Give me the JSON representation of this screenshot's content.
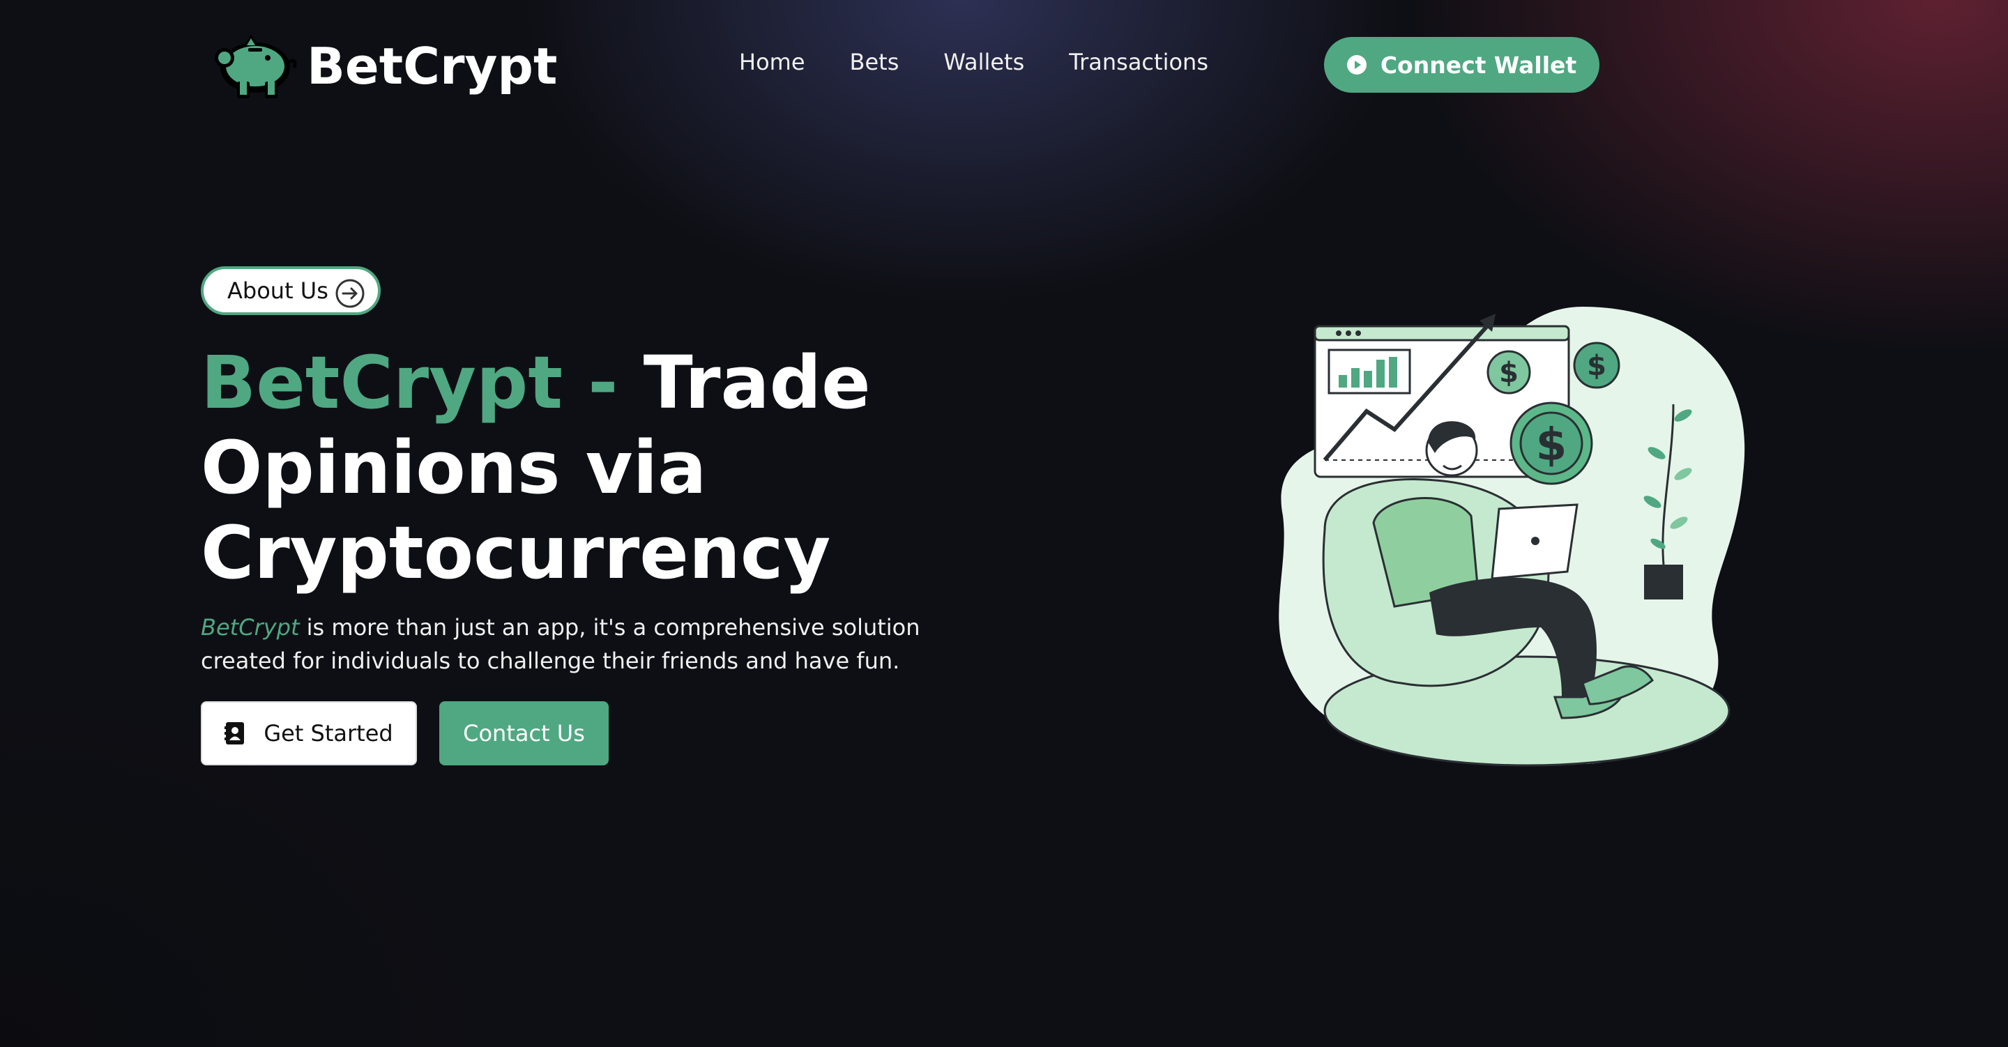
{
  "brand": {
    "name": "BetCrypt"
  },
  "nav": {
    "items": [
      {
        "label": "Home"
      },
      {
        "label": "Bets"
      },
      {
        "label": "Wallets"
      },
      {
        "label": "Transactions"
      }
    ],
    "connect_label": "Connect Wallet"
  },
  "hero": {
    "pill_label": "About Us",
    "title_accent": "BetCrypt -",
    "title_rest": "Trade Opinions via Cryptocurrency",
    "desc_brand": "BetCrypt",
    "desc_rest": "is more than just an app, it's a comprehensive solution created for individuals to challenge their friends and have fun.",
    "primary_button": "Get Started",
    "secondary_button": "Contact Us"
  },
  "colors": {
    "accent": "#4fa882",
    "background": "#0e0f14",
    "text": "#ffffff"
  },
  "icons": {
    "logo": "piggy-bank-icon",
    "connect": "play-circle-icon",
    "pill": "arrow-right-circle-icon",
    "get_started": "contact-book-icon"
  }
}
